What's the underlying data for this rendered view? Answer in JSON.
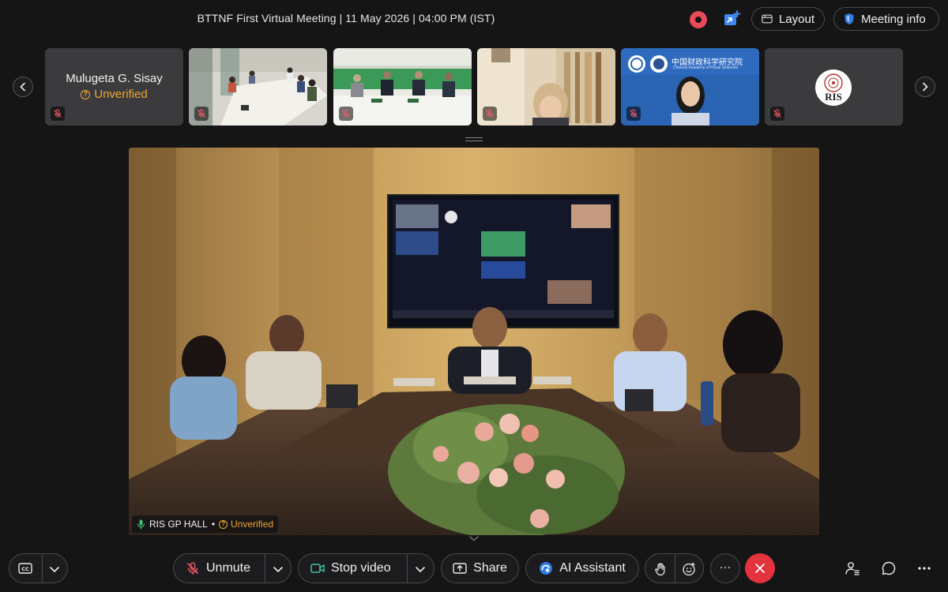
{
  "meeting": {
    "title": "BTTNF First Virtual Meeting | 11 May 2026 | 04:00 PM (IST)"
  },
  "header": {
    "layout_label": "Layout",
    "meeting_info_label": "Meeting info"
  },
  "filmstrip": {
    "tiles": [
      {
        "type": "name",
        "name": "Mulugeta G. Sisay",
        "status": "Unverified",
        "muted": true
      },
      {
        "type": "video",
        "scene": "conference-room",
        "muted": true
      },
      {
        "type": "video",
        "scene": "panel-green-wall",
        "muted": true
      },
      {
        "type": "video",
        "scene": "woman-bookshelf",
        "muted": true
      },
      {
        "type": "video",
        "scene": "chinese-academy-backdrop",
        "logo_text_cn": "中国财政科学研究院",
        "logo_text_en": "Chinese Academy of Fiscal Sciences",
        "muted": true
      },
      {
        "type": "logo",
        "logo_text": "RIS",
        "muted": true
      }
    ]
  },
  "stage": {
    "participant_name": "RIS GP HALL",
    "separator": "•",
    "status": "Unverified"
  },
  "toolbar": {
    "unmute_label": "Unmute",
    "stop_video_label": "Stop video",
    "share_label": "Share",
    "ai_assistant_label": "AI Assistant",
    "more_label": "···"
  },
  "colors": {
    "background": "#151516",
    "accent_warning": "#f0a732",
    "record": "#e84a5a",
    "end_call": "#e2333f",
    "ai_blue": "#2f7de1",
    "shield_blue": "#2f7de1"
  }
}
